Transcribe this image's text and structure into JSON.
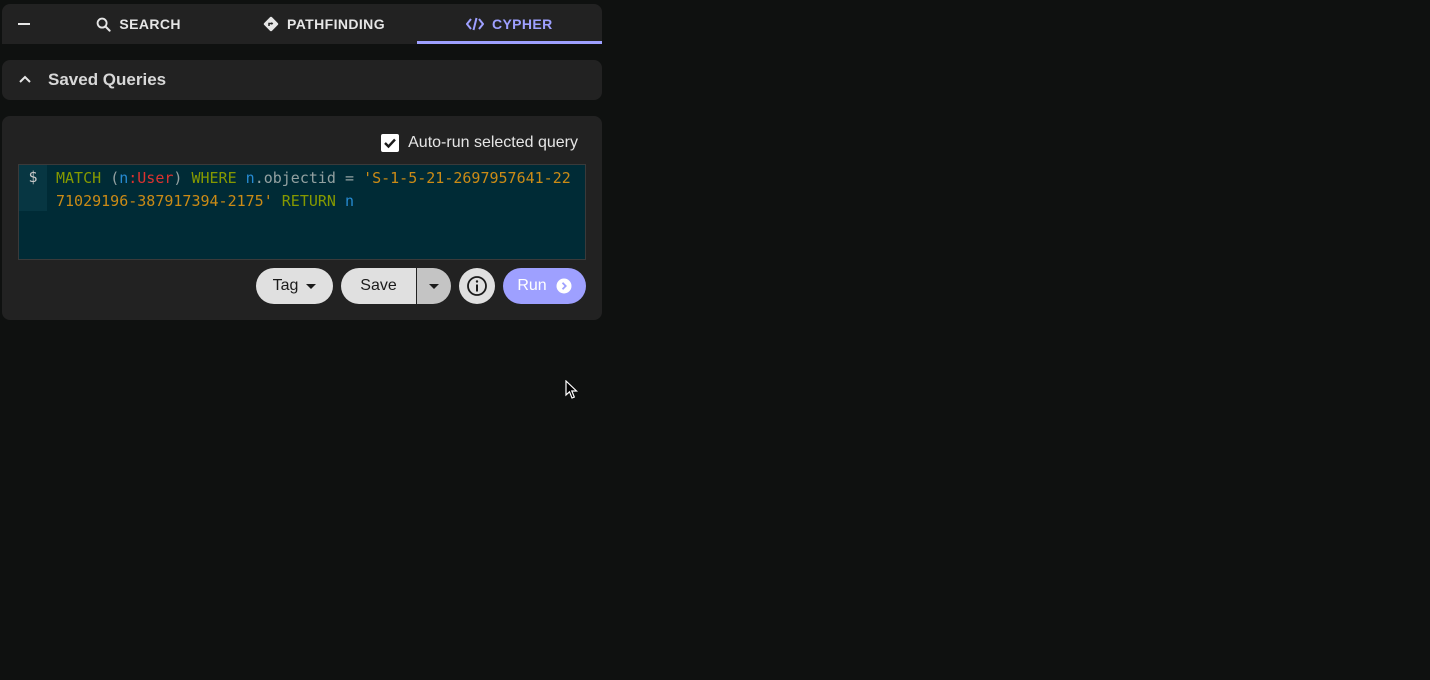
{
  "tabs": {
    "items": [
      {
        "label": "SEARCH",
        "icon": "search-icon"
      },
      {
        "label": "PATHFINDING",
        "icon": "diamond-directions-icon"
      },
      {
        "label": "CYPHER",
        "icon": "code-icon",
        "active": true
      }
    ],
    "active_color": "#9ea0ff"
  },
  "saved_queries": {
    "title": "Saved Queries"
  },
  "cypher": {
    "autorun_label": "Auto-run selected query",
    "autorun_checked": true,
    "prompt": "$",
    "query": {
      "match": "MATCH",
      "open_paren": "(",
      "var1": "n",
      "colon_label": ":User",
      "close_paren": ")",
      "where": "WHERE",
      "var2": "n",
      "prop": ".objectid = ",
      "value": "'S-1-5-21-2697957641-2271029196-387917394-2175'",
      "return": "RETURN",
      "var3": "n"
    }
  },
  "actions": {
    "tag_label": "Tag",
    "save_label": "Save",
    "run_label": "Run"
  }
}
